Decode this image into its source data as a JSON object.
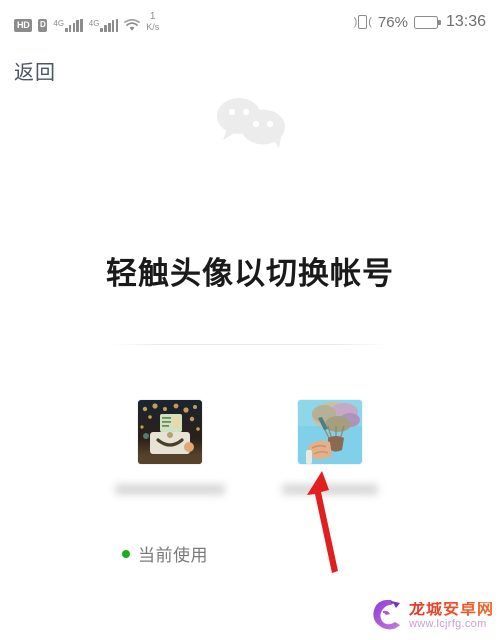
{
  "status_bar": {
    "hd_label": "HD",
    "sim_label": "D",
    "network_gen_1": "4G",
    "network_gen_2": "4G",
    "net_speed_value": "1",
    "net_speed_unit": "K/s",
    "battery_percent": "76%",
    "clock": "13:36",
    "icons": {
      "wifi": "wifi-icon",
      "vibrate": "vibrate-icon",
      "battery": "battery-icon"
    }
  },
  "nav": {
    "back_label": "返回"
  },
  "brand": {
    "logo_name": "wechat-logo",
    "logo_color": "#ededed"
  },
  "main": {
    "headline": "轻触头像以切换帐号",
    "accounts": [
      {
        "avatar_name": "account-avatar-cake-photo",
        "nickname_redacted": "",
        "is_current": true
      },
      {
        "avatar_name": "account-avatar-flowers-photo",
        "nickname_redacted": "",
        "is_current": false
      }
    ],
    "current_status_label": "当前使用",
    "current_status_color": "#1aad19"
  },
  "annotation": {
    "arrow_name": "red-arrow-annotation",
    "arrow_color": "#e01f1f"
  },
  "watermark": {
    "site_name": "龙城安卓网",
    "site_url": "www.lcjrfg.com",
    "logo_name": "dragon-logo",
    "logo_color": "#9b4fd0"
  }
}
